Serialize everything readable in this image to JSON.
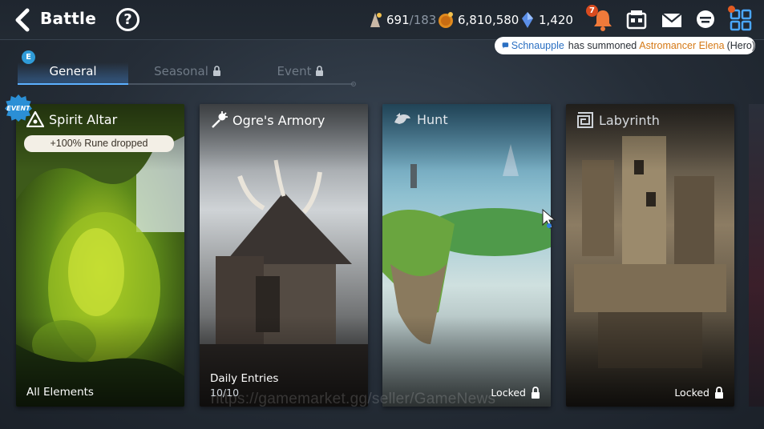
{
  "header": {
    "title": "Battle",
    "help_glyph": "?",
    "resources": [
      {
        "name": "skystone-ticket",
        "value": "691",
        "max": "/183"
      },
      {
        "name": "gold",
        "value": "6,810,580"
      },
      {
        "name": "crystal",
        "value": "1,420"
      }
    ],
    "notification_count": "7"
  },
  "notice": {
    "user": "Schnaupple",
    "text": "has summoned",
    "hero": "Astromancer Elena",
    "role": "(Hero)"
  },
  "tabs": {
    "badge": "E",
    "items": [
      {
        "label": "General",
        "active": true,
        "locked": false
      },
      {
        "label": "Seasonal",
        "active": false,
        "locked": true
      },
      {
        "label": "Event",
        "active": false,
        "locked": true
      }
    ]
  },
  "cards": [
    {
      "title": "Spirit Altar",
      "icon": "altar-icon",
      "pill": "+100% Rune dropped",
      "event_badge": "EVENT",
      "bottom": "All Elements",
      "sub": ""
    },
    {
      "title": "Ogre's Armory",
      "icon": "mace-icon",
      "bottom": "Daily Entries",
      "sub": "10/10"
    },
    {
      "title": "Hunt",
      "icon": "dragon-icon",
      "status": "Locked"
    },
    {
      "title": "Labyrinth",
      "icon": "maze-icon",
      "status": "Locked"
    }
  ],
  "watermark": "https://gamemarket.gg/seller/GameNews",
  "colors": {
    "accent": "#5cb0ff",
    "hero_name": "#d57916",
    "user_name": "#2a6fc2",
    "alert": "#d94b1f"
  }
}
